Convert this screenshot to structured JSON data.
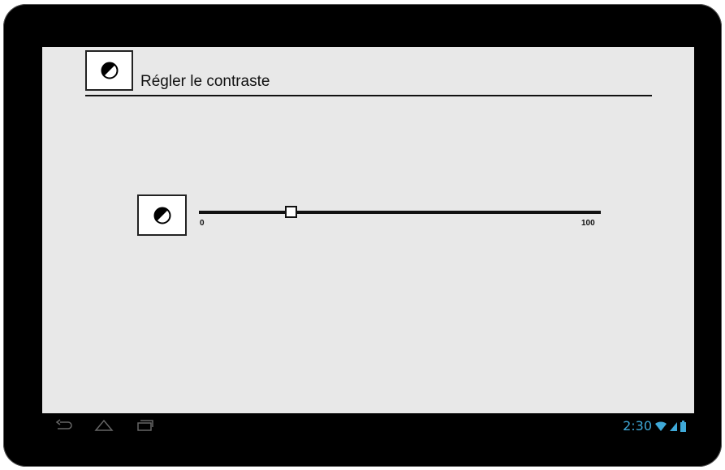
{
  "header": {
    "title": "Régler le contraste",
    "icon": "contrast-icon"
  },
  "slider": {
    "icon": "contrast-icon",
    "min_label": "0",
    "max_label": "100",
    "value": 23
  },
  "navbar": {
    "back_icon": "back-icon",
    "home_icon": "home-icon",
    "recents_icon": "recent-apps-icon"
  },
  "status_bar": {
    "time": "2:30",
    "wifi_icon": "wifi-icon",
    "signal_icon": "signal-icon",
    "battery_icon": "battery-icon"
  },
  "colors": {
    "screen_bg": "#e8e8e8",
    "status_accent": "#3fa9d8"
  }
}
